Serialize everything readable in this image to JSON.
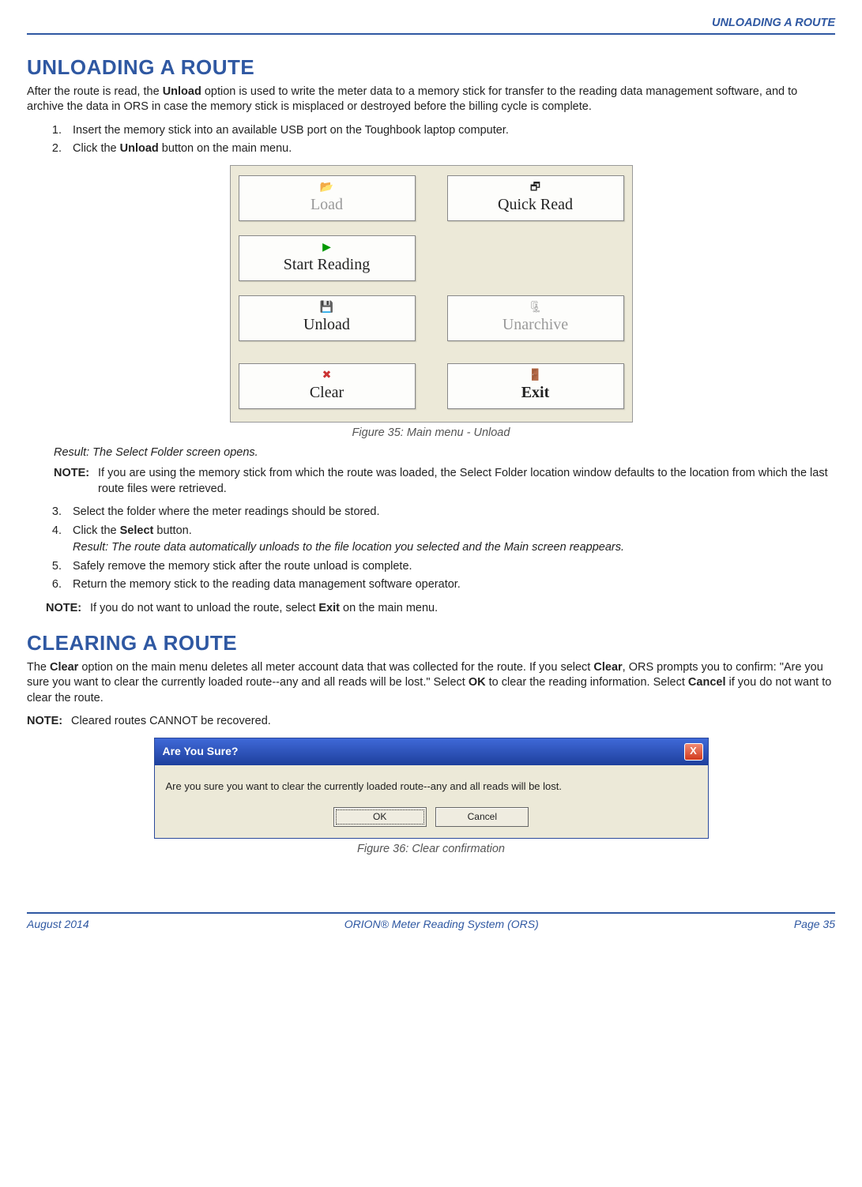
{
  "header": {
    "running_head": "UNLOADING A ROUTE"
  },
  "section1": {
    "title": "UNLOADING A ROUTE",
    "intro_pre": "After the route is read, the ",
    "intro_bold": "Unload",
    "intro_post": " option is used to write the meter data to a memory stick for transfer to the reading data management software, and to archive the data in ORS in case the memory stick is misplaced or destroyed before the billing cycle is complete.",
    "step1": "Insert the memory stick into an available USB port on the Toughbook laptop computer.",
    "step2_pre": "Click the ",
    "step2_bold": "Unload",
    "step2_post": " button on the main menu.",
    "fig35_caption": "Figure 35:  Main menu - Unload",
    "result1": "Result: The Select Folder screen opens.",
    "note1_label": "NOTE:",
    "note1_text": "If you are using the memory stick from which the route was loaded, the Select Folder location window defaults to the location from which the last route files were retrieved.",
    "step3": "Select the folder where the meter readings should be stored.",
    "step4_pre": "Click the ",
    "step4_bold": "Select",
    "step4_post": " button.",
    "result2": "Result: The route data automatically unloads to the file location you selected and the Main screen reappears.",
    "step5": "Safely remove the memory stick after the route unload is complete.",
    "step6": "Return the memory stick to the reading data management software operator.",
    "note2_label": "NOTE:",
    "note2_pre": "If you do not want to unload the route, select ",
    "note2_bold": "Exit",
    "note2_post": " on the main menu."
  },
  "fig35": {
    "buttons": {
      "load": "Load",
      "quick_read": "Quick Read",
      "start_reading": "Start Reading",
      "unload": "Unload",
      "unarchive": "Unarchive",
      "clear": "Clear",
      "exit": "Exit"
    },
    "icons": {
      "load": "📂",
      "quick_read": "🗗",
      "start_reading": "▶",
      "unload": "💾",
      "unarchive": "🗜",
      "clear": "✖",
      "exit": "🚪"
    }
  },
  "section2": {
    "title": "CLEARING A ROUTE",
    "p_pre": "The ",
    "p_b1": "Clear",
    "p_mid1": " option on the main menu deletes all meter account data that was collected for the route. If you select ",
    "p_b2": "Clear",
    "p_mid2": ", ORS prompts you to confirm: \"Are you sure you want to clear the currently loaded route--any and all reads will be lost.\" Select ",
    "p_b3": "OK",
    "p_mid3": " to clear the reading information. Select ",
    "p_b4": "Cancel",
    "p_post": " if you do not want to clear the route.",
    "note_label": "NOTE:",
    "note_text": "Cleared routes CANNOT be recovered.",
    "fig36_caption": "Figure 36:  Clear confirmation"
  },
  "fig36": {
    "title": "Are You Sure?",
    "close": "X",
    "message": "Are you sure you want to clear the currently loaded route--any and all reads will be lost.",
    "ok": "OK",
    "cancel": "Cancel"
  },
  "footer": {
    "left": "August 2014",
    "center": "ORION® Meter Reading System (ORS)",
    "right": "Page 35"
  }
}
